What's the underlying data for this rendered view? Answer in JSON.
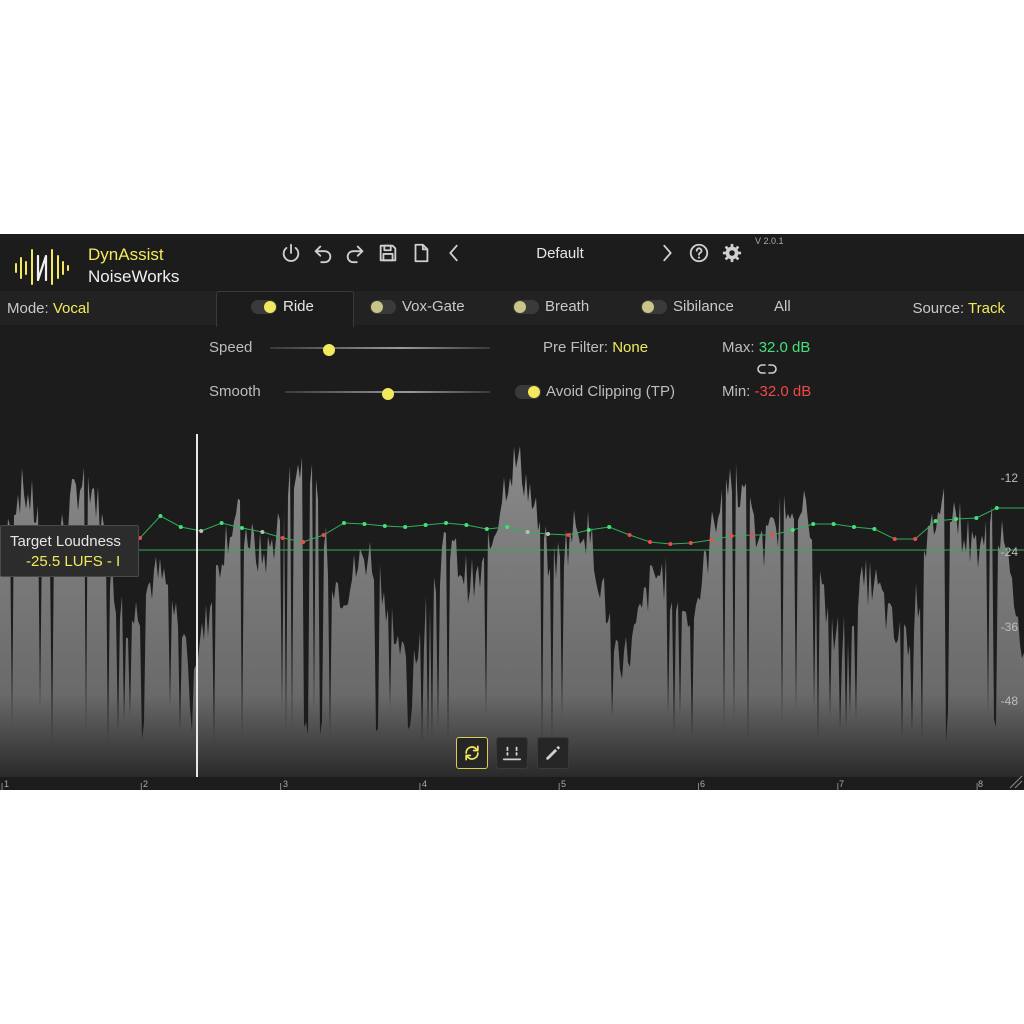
{
  "brand": {
    "line1": "DynAssist",
    "line2": "NoiseWorks"
  },
  "version": "V 2.0.1",
  "toolbar": {
    "icons": [
      "power-icon",
      "undo-icon",
      "redo-icon",
      "save-icon",
      "new-file-icon",
      "chevron-left-icon",
      "chevron-right-icon",
      "help-icon",
      "gear-icon"
    ],
    "preset": "Default"
  },
  "mode": {
    "label": "Mode:",
    "value": "Vocal"
  },
  "source": {
    "label": "Source:",
    "value": "Track"
  },
  "tabs": [
    {
      "label": "Ride",
      "enabled": true,
      "active": true
    },
    {
      "label": "Vox-Gate",
      "enabled": false,
      "active": false
    },
    {
      "label": "Breath",
      "enabled": false,
      "active": false
    },
    {
      "label": "Sibilance",
      "enabled": false,
      "active": false
    },
    {
      "label": "All",
      "active": false
    }
  ],
  "controls": {
    "speed": {
      "label": "Speed",
      "value": 0.27
    },
    "smooth": {
      "label": "Smooth",
      "value": 0.5
    },
    "pre_filter": {
      "label": "Pre Filter:",
      "value": "None"
    },
    "avoid_clipping": {
      "label": "Avoid Clipping (TP)",
      "enabled": true
    },
    "max": {
      "label": "Max:",
      "value": "32.0 dB"
    },
    "min": {
      "label": "Min:",
      "value": "-32.0 dB"
    }
  },
  "graph": {
    "db_scale": [
      "-12",
      "-24",
      "-36",
      "-48"
    ],
    "target": {
      "label": "Target Loudness",
      "value": "-25.5 LUFS - I"
    },
    "ruler": [
      "1",
      "2",
      "3",
      "4",
      "5",
      "6",
      "7",
      "8"
    ],
    "playhead_bar": 2.4
  },
  "colors": {
    "accent": "#f2ea5c",
    "max": "#46e07a",
    "min": "#f04848",
    "background": "#1c1c1c"
  },
  "bottom_buttons": [
    "loop-icon",
    "range-icon",
    "pencil-icon"
  ]
}
